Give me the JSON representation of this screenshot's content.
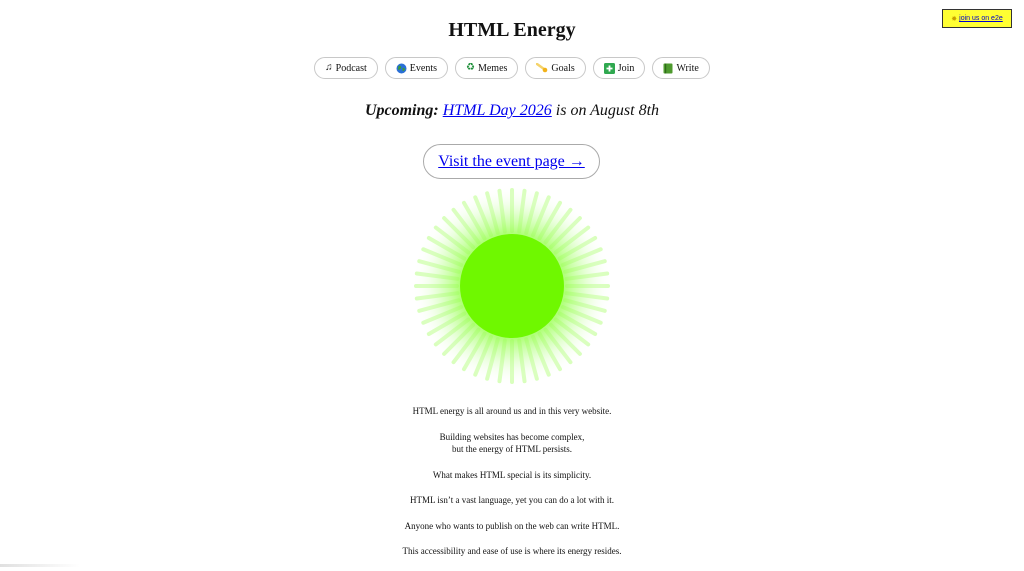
{
  "badge": {
    "label": "join us on e2e"
  },
  "header": {
    "title": "HTML Energy"
  },
  "nav": {
    "items": [
      {
        "label": "Podcast",
        "icon": "music-note-icon"
      },
      {
        "label": "Events",
        "icon": "globe-icon"
      },
      {
        "label": "Memes",
        "icon": "recycle-icon"
      },
      {
        "label": "Goals",
        "icon": "comet-icon"
      },
      {
        "label": "Join",
        "icon": "plus-square-icon"
      },
      {
        "label": "Write",
        "icon": "green-book-icon"
      }
    ]
  },
  "upcoming": {
    "prefix": "Upcoming:",
    "link": "HTML Day 2026",
    "suffix": "is on August 8th"
  },
  "cta": {
    "label": "Visit the event page →"
  },
  "sun": {
    "core_color": "#6ff800",
    "glow_color": "#8cff3a"
  },
  "intro": {
    "line1": "HTML energy is all around us and in this very website.",
    "line2a": "Building websites has become complex,",
    "line2b": "but the energy of HTML persists.",
    "line3": "What makes HTML special is its simplicity.",
    "line4": "HTML isn’t a vast language, yet you can do a lot with it.",
    "line5": "Anyone who wants to publish on the web can write HTML.",
    "line6": "This accessibility and ease of use is where its energy resides."
  },
  "colors": {
    "link": "#0000ee",
    "badge_bg": "#ffff33"
  }
}
